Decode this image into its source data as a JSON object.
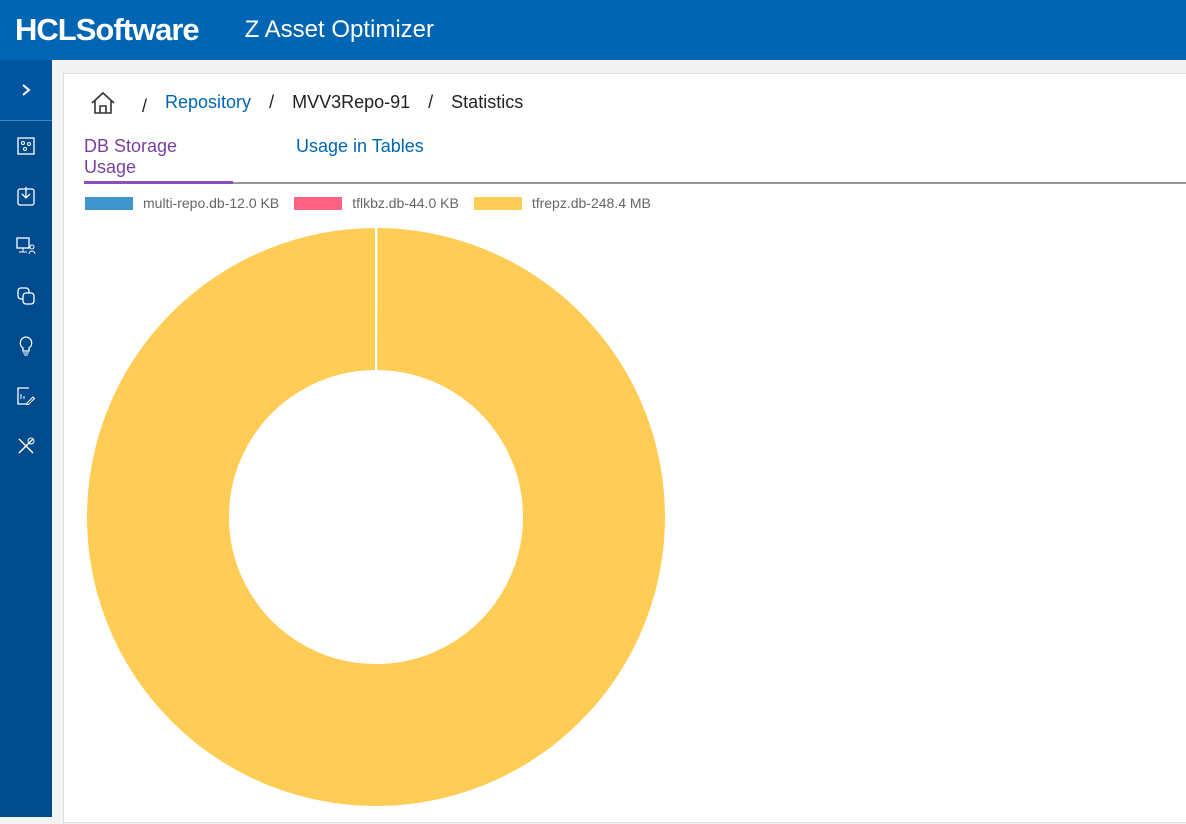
{
  "header": {
    "logo": "HCLSoftware",
    "app_title": "Z Asset Optimizer"
  },
  "sidebar": {
    "items": [
      {
        "icon": "expand-chevron-icon"
      },
      {
        "icon": "assets-icon"
      },
      {
        "icon": "import-icon"
      },
      {
        "icon": "monitor-user-icon"
      },
      {
        "icon": "copy-layers-icon"
      },
      {
        "icon": "lightbulb-icon"
      },
      {
        "icon": "report-edit-icon"
      },
      {
        "icon": "tools-icon"
      }
    ]
  },
  "breadcrumb": {
    "home_icon": "home-icon",
    "items": [
      "Repository",
      "MVV3Repo-91",
      "Statistics"
    ]
  },
  "tabs": [
    {
      "label": "DB Storage Usage",
      "active": true
    },
    {
      "label": "Usage in Tables",
      "active": false
    }
  ],
  "chart_data": {
    "type": "pie",
    "donut": true,
    "title": "",
    "legend_position": "top-left",
    "series": [
      {
        "name": "multi-repo.db-12.0 KB",
        "value_kb": 12.0,
        "color": "#3e95cd"
      },
      {
        "name": "tflkbz.db-44.0 KB",
        "value_kb": 44.0,
        "color": "#ff6384"
      },
      {
        "name": "tfrepz.db-248.4 MB",
        "value_kb": 254361.6,
        "color": "#ffcd56"
      }
    ]
  }
}
